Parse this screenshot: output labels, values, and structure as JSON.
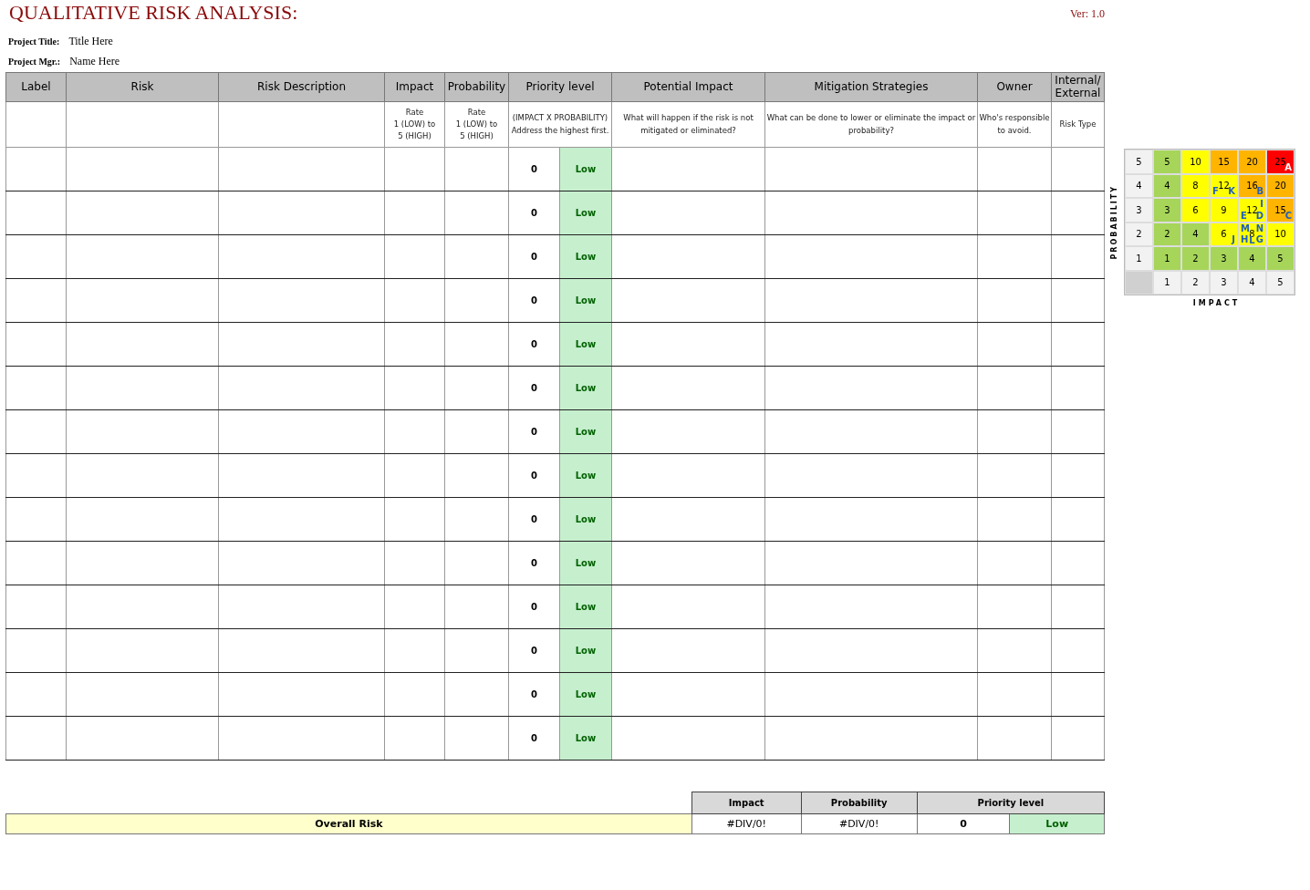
{
  "title": "QUALITATIVE RISK ANALYSIS:",
  "version": "Ver: 1.0",
  "project": [
    {
      "label": "Project Title:",
      "value": "Title Here"
    },
    {
      "label": "Project Mgr.:",
      "value": "Name Here"
    }
  ],
  "table": {
    "columns": [
      {
        "heading": "Label"
      },
      {
        "heading": "Risk"
      },
      {
        "heading": "Risk Description"
      },
      {
        "heading": "Impact",
        "note": "Rate\n1 (LOW) to\n5 (HIGH)"
      },
      {
        "heading": "Probability",
        "note": "Rate\n1 (LOW) to\n5 (HIGH)"
      },
      {
        "heading": "Priority level",
        "note": "(IMPACT X PROBABILITY)\nAddress the  highest first."
      },
      {
        "heading": "Potential Impact",
        "note": "What will happen if the risk is not\nmitigated or eliminated?"
      },
      {
        "heading": "Mitigation Strategies",
        "note": "What can be done to lower or eliminate the impact or\nprobability?"
      },
      {
        "heading": "Owner",
        "note": "Who's responsible\nto avoid."
      },
      {
        "heading": "Internal/\nExternal",
        "note": "Risk Type"
      }
    ],
    "rows": [
      {
        "score": "0",
        "priority": "Low"
      },
      {
        "score": "0",
        "priority": "Low"
      },
      {
        "score": "0",
        "priority": "Low"
      },
      {
        "score": "0",
        "priority": "Low"
      },
      {
        "score": "0",
        "priority": "Low"
      },
      {
        "score": "0",
        "priority": "Low"
      },
      {
        "score": "0",
        "priority": "Low"
      },
      {
        "score": "0",
        "priority": "Low"
      },
      {
        "score": "0",
        "priority": "Low"
      },
      {
        "score": "0",
        "priority": "Low"
      },
      {
        "score": "0",
        "priority": "Low"
      },
      {
        "score": "0",
        "priority": "Low"
      },
      {
        "score": "0",
        "priority": "Low"
      },
      {
        "score": "0",
        "priority": "Low"
      }
    ]
  },
  "overall": {
    "label": "Overall Risk",
    "headings": [
      "Impact",
      "Probability",
      "Priority level"
    ],
    "impact": "#DIV/0!",
    "probability": "#DIV/0!",
    "score": "0",
    "priority": "Low"
  },
  "matrix": {
    "ylabel": "PROBABILITY",
    "xlabel": "IMPACT",
    "impact_labels": [
      "1",
      "2",
      "3",
      "4",
      "5"
    ],
    "rows": [
      {
        "probability": "5",
        "cells": [
          {
            "value": "5",
            "color": "#a6d55a"
          },
          {
            "value": "10",
            "color": "#ffff00"
          },
          {
            "value": "15",
            "color": "#ffb400"
          },
          {
            "value": "20",
            "color": "#ffb400"
          },
          {
            "value": "25",
            "color": "#ff0000",
            "letters": [
              "A"
            ]
          }
        ]
      },
      {
        "probability": "4",
        "cells": [
          {
            "value": "4",
            "color": "#a6d55a"
          },
          {
            "value": "8",
            "color": "#ffff00"
          },
          {
            "value": "12",
            "color": "#ffff00",
            "letters": [
              "F",
              "K"
            ]
          },
          {
            "value": "16",
            "color": "#ffb400",
            "letters": [
              "B"
            ]
          },
          {
            "value": "20",
            "color": "#ffb400"
          }
        ]
      },
      {
        "probability": "3",
        "cells": [
          {
            "value": "3",
            "color": "#a6d55a"
          },
          {
            "value": "6",
            "color": "#ffff00"
          },
          {
            "value": "9",
            "color": "#ffff00"
          },
          {
            "value": "12",
            "color": "#ffff00",
            "letters": [
              "I",
              "E",
              "D"
            ]
          },
          {
            "value": "15",
            "color": "#ffb400",
            "letters": [
              "C"
            ]
          }
        ]
      },
      {
        "probability": "2",
        "cells": [
          {
            "value": "2",
            "color": "#a6d55a"
          },
          {
            "value": "4",
            "color": "#a6d55a"
          },
          {
            "value": "6",
            "color": "#ffff00",
            "letters": [
              "J"
            ]
          },
          {
            "value": "8",
            "color": "#ffff00",
            "letters": [
              "M",
              "N",
              "H",
              "L",
              "G"
            ]
          },
          {
            "value": "10",
            "color": "#ffff00"
          }
        ]
      },
      {
        "probability": "1",
        "cells": [
          {
            "value": "1",
            "color": "#a6d55a"
          },
          {
            "value": "2",
            "color": "#a6d55a"
          },
          {
            "value": "3",
            "color": "#a6d55a"
          },
          {
            "value": "4",
            "color": "#a6d55a"
          },
          {
            "value": "5",
            "color": "#a6d55a"
          }
        ]
      }
    ]
  }
}
